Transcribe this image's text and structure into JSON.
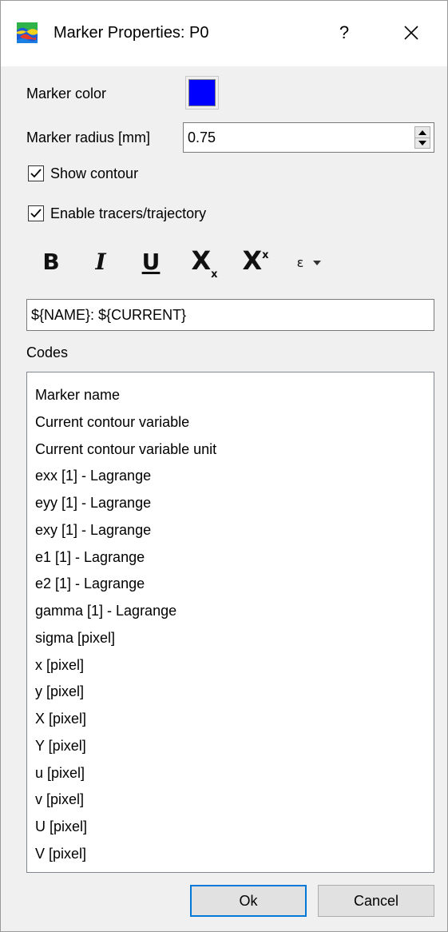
{
  "window": {
    "title": "Marker Properties: P0",
    "help_label": "?"
  },
  "form": {
    "marker_color_label": "Marker color",
    "marker_color_value": "#0000ff",
    "marker_radius_label": "Marker radius [mm]",
    "marker_radius_value": "0.75",
    "show_contour_label": "Show contour",
    "show_contour_checked": true,
    "enable_tracers_label": "Enable tracers/trajectory",
    "enable_tracers_checked": true
  },
  "toolbar": {
    "bold": "B",
    "italic": "I",
    "underline": "U",
    "subscript_main": "X",
    "subscript_sub": "x",
    "superscript_main": "X",
    "superscript_sup": "x",
    "symbol": "ε"
  },
  "label_text": {
    "value": "${NAME}: ${CURRENT}"
  },
  "codes": {
    "label": "Codes",
    "items": [
      "Marker name",
      "Current contour variable",
      "Current contour variable unit",
      "exx [1] - Lagrange",
      "eyy [1] - Lagrange",
      "exy [1] - Lagrange",
      "e1 [1] - Lagrange",
      "e2 [1] - Lagrange",
      "gamma [1] - Lagrange",
      "sigma [pixel]",
      "x [pixel]",
      "y [pixel]",
      "X [pixel]",
      "Y [pixel]",
      "u [pixel]",
      "v [pixel]",
      "U [pixel]",
      "V [pixel]"
    ]
  },
  "buttons": {
    "ok": "Ok",
    "cancel": "Cancel"
  },
  "icons": {
    "app": "colormap-app-icon",
    "close": "close-icon",
    "check": "checkmark-icon",
    "spin_up": "triangle-up-icon",
    "spin_down": "triangle-down-icon",
    "dropdown": "triangle-down-icon"
  }
}
